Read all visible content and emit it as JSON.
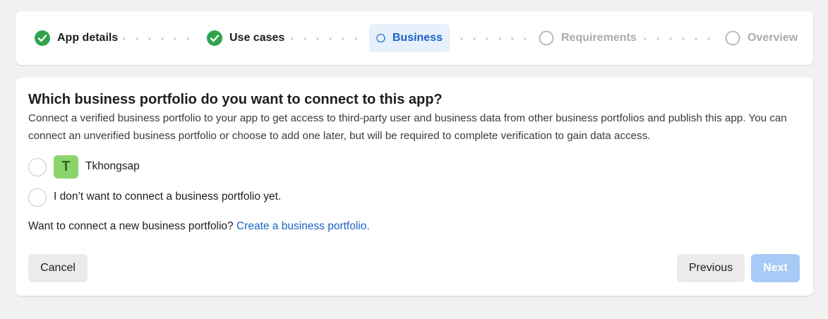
{
  "stepper": {
    "steps": [
      {
        "label": "App details",
        "state": "done"
      },
      {
        "label": "Use cases",
        "state": "done"
      },
      {
        "label": "Business",
        "state": "current"
      },
      {
        "label": "Requirements",
        "state": "todo"
      },
      {
        "label": "Overview",
        "state": "todo"
      }
    ]
  },
  "main": {
    "title": "Which business portfolio do you want to connect to this app?",
    "description": "Connect a verified business portfolio to your app to get access to third-party user and business data from other business portfolios and publish this app. You can connect an unverified business portfolio or choose to add one later, but will be required to complete verification to gain data access.",
    "options": [
      {
        "avatar_letter": "T",
        "label": "Tkhongsap",
        "selected": false
      },
      {
        "label": "I don’t want to connect a business portfolio yet.",
        "selected": false
      }
    ],
    "connect_prompt": "Want to connect a new business portfolio?",
    "connect_link": "Create a business portfolio."
  },
  "buttons": {
    "cancel": "Cancel",
    "previous": "Previous",
    "next": "Next"
  },
  "colors": {
    "accent": "#1c62c6",
    "success": "#31a24c",
    "avatar_bg": "#8bd46c",
    "next_disabled": "#a6cbf6"
  }
}
